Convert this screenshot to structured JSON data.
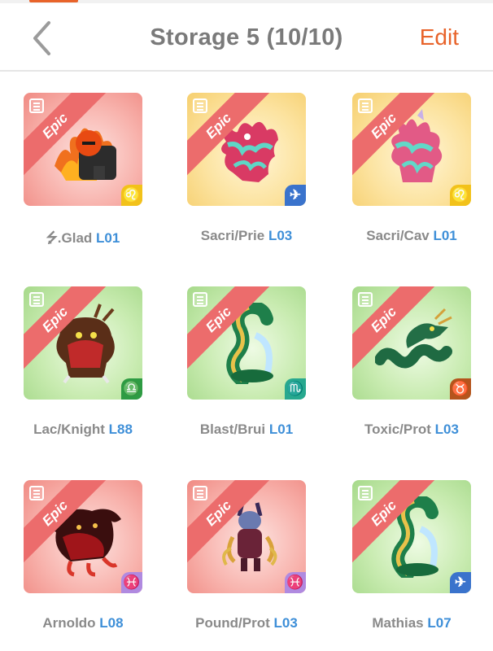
{
  "header": {
    "title": "Storage 5 (10/10)",
    "edit_label": "Edit",
    "back_icon": "chevron-left-icon"
  },
  "badge_text": "Epic",
  "slots": [
    {
      "name": "⭍.Glad",
      "level": "L01",
      "bg": "red",
      "zodiac": "♌",
      "zodiac_color": "#f2c21a"
    },
    {
      "name": "Sacri/Prie",
      "level": "L03",
      "bg": "yellow",
      "zodiac": "✈",
      "zodiac_color": "#3a73cc"
    },
    {
      "name": "Sacri/Cav",
      "level": "L01",
      "bg": "yellow",
      "zodiac": "♌",
      "zodiac_color": "#f2c21a"
    },
    {
      "name": "Lac/Knight",
      "level": "L88",
      "bg": "green",
      "zodiac": "♎",
      "zodiac_color": "#2e9b43"
    },
    {
      "name": "Blast/Brui",
      "level": "L01",
      "bg": "green",
      "zodiac": "♏",
      "zodiac_color": "#27a88f"
    },
    {
      "name": "Toxic/Prot",
      "level": "L03",
      "bg": "green",
      "zodiac": "♉",
      "zodiac_color": "#b5541c"
    },
    {
      "name": "Arnoldo",
      "level": "L08",
      "bg": "red",
      "zodiac": "♓",
      "zodiac_color": "#b08ae0"
    },
    {
      "name": "Pound/Prot",
      "level": "L03",
      "bg": "red",
      "zodiac": "♓",
      "zodiac_color": "#b08ae0"
    },
    {
      "name": "Mathias",
      "level": "L07",
      "bg": "green",
      "zodiac": "✈",
      "zodiac_color": "#3a73cc"
    }
  ]
}
